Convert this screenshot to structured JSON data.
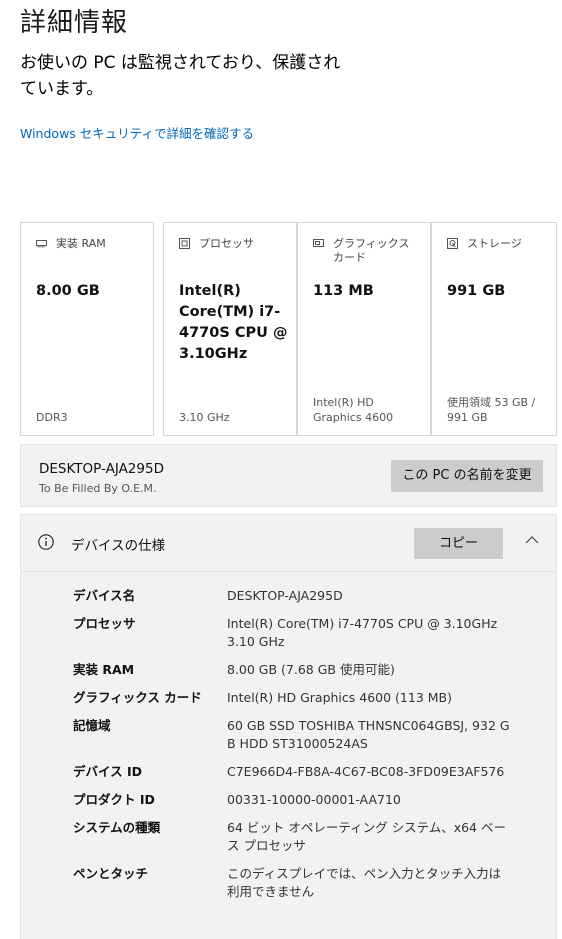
{
  "header": {
    "title": "詳細情報",
    "subtitle": "お使いの PC は監視されており、保護されています。",
    "security_link": "Windows セキュリティで詳細を確認する"
  },
  "cards": [
    {
      "icon": "ram-icon",
      "label": "実装 RAM",
      "value": "8.00 GB",
      "footer": "DDR3"
    },
    {
      "icon": "processor-icon",
      "label": "プロセッサ",
      "value": "Intel(R) Core(TM) i7-4770S CPU @ 3.10GHz",
      "footer": "3.10 GHz"
    },
    {
      "icon": "graphics-card-icon",
      "label": "グラフィックス カード",
      "value": "113 MB",
      "footer": "Intel(R) HD Graphics 4600"
    },
    {
      "icon": "storage-icon",
      "label": "ストレージ",
      "value": "991 GB",
      "footer": "使用領域 53 GB / 991 GB"
    }
  ],
  "pc_name": {
    "name": "DESKTOP-AJA295D",
    "subtext": "To Be Filled By O.E.M.",
    "rename_button": "この PC の名前を変更"
  },
  "device_specs": {
    "title": "デバイスの仕様",
    "copy_button": "コピー",
    "rows": [
      {
        "label": "デバイス名",
        "value": "DESKTOP-AJA295D"
      },
      {
        "label": "プロセッサ",
        "value": "Intel(R) Core(TM) i7-4770S CPU @ 3.10GHz 3.10 GHz"
      },
      {
        "label": "実装 RAM",
        "value": "8.00 GB (7.68 GB 使用可能)"
      },
      {
        "label": "グラフィックス カード",
        "value": "Intel(R) HD Graphics 4600 (113 MB)"
      },
      {
        "label": "記憶域",
        "value": "60 GB SSD TOSHIBA THNSNC064GBSJ, 932 GB HDD ST31000524AS"
      },
      {
        "label": "デバイス ID",
        "value": "C7E966D4-FB8A-4C67-BC08-3FD09E3AF576"
      },
      {
        "label": "プロダクト ID",
        "value": "00331-10000-00001-AA710"
      },
      {
        "label": "システムの種類",
        "value": "64 ビット オペレーティング システム、x64 ベース プロセッサ"
      },
      {
        "label": "ペンとタッチ",
        "value": "このディスプレイでは、ペン入力とタッチ入力は利用できません"
      }
    ]
  },
  "colors": {
    "link": "#0067b8",
    "panel_bg": "#f2f2f2",
    "button_bg": "#cccccc"
  }
}
